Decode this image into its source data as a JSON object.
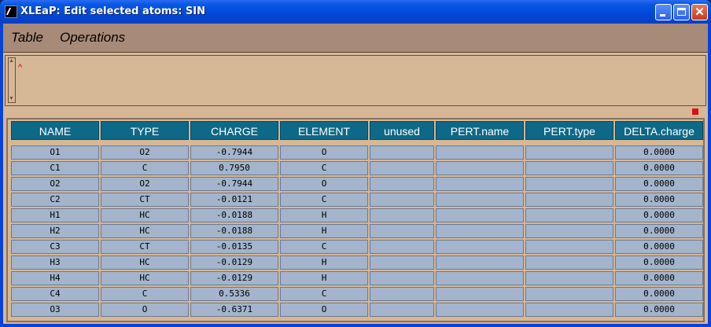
{
  "window": {
    "title": "XLEaP: Edit selected atoms: SIN"
  },
  "menubar": {
    "items": [
      "Table",
      "Operations"
    ]
  },
  "textarea": {
    "caret": "^"
  },
  "table": {
    "headers": [
      "NAME",
      "TYPE",
      "CHARGE",
      "ELEMENT",
      "unused",
      "PERT.name",
      "PERT.type",
      "DELTA.charge"
    ],
    "rows": [
      [
        "O1",
        "O2",
        "-0.7944",
        "O",
        "",
        "",
        "",
        "0.0000"
      ],
      [
        "C1",
        "C",
        "0.7950",
        "C",
        "",
        "",
        "",
        "0.0000"
      ],
      [
        "O2",
        "O2",
        "-0.7944",
        "O",
        "",
        "",
        "",
        "0.0000"
      ],
      [
        "C2",
        "CT",
        "-0.0121",
        "C",
        "",
        "",
        "",
        "0.0000"
      ],
      [
        "H1",
        "HC",
        "-0.0188",
        "H",
        "",
        "",
        "",
        "0.0000"
      ],
      [
        "H2",
        "HC",
        "-0.0188",
        "H",
        "",
        "",
        "",
        "0.0000"
      ],
      [
        "C3",
        "CT",
        "-0.0135",
        "C",
        "",
        "",
        "",
        "0.0000"
      ],
      [
        "H3",
        "HC",
        "-0.0129",
        "H",
        "",
        "",
        "",
        "0.0000"
      ],
      [
        "H4",
        "HC",
        "-0.0129",
        "H",
        "",
        "",
        "",
        "0.0000"
      ],
      [
        "C4",
        "C",
        "0.5336",
        "C",
        "",
        "",
        "",
        "0.0000"
      ],
      [
        "O3",
        "O",
        "-0.6371",
        "O",
        "",
        "",
        "",
        "0.0000"
      ]
    ]
  }
}
